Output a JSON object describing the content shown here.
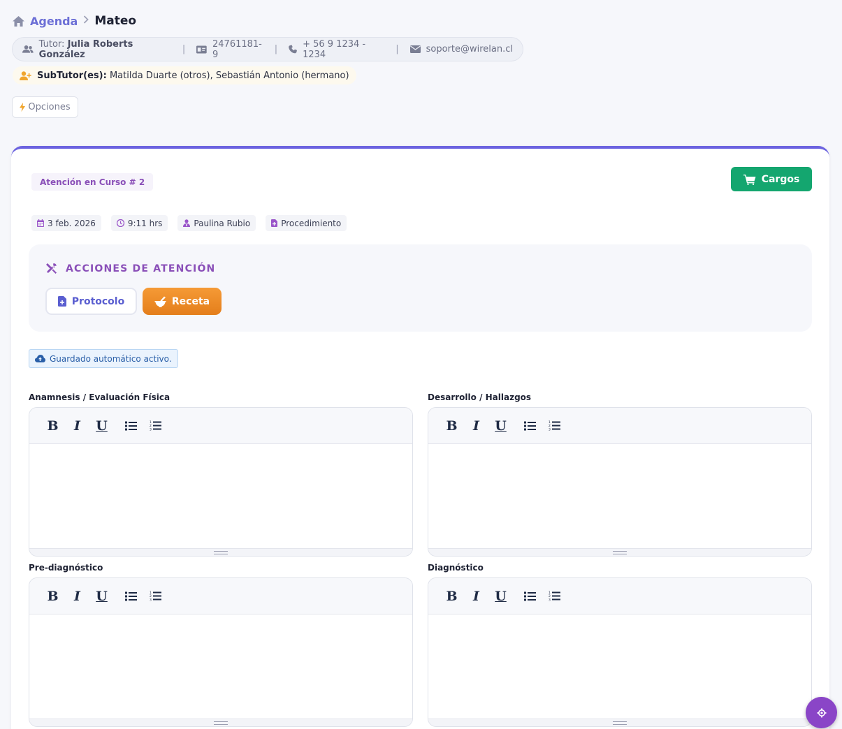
{
  "breadcrumb": {
    "home_icon": "home-icon",
    "link": "Agenda",
    "current": "Mateo"
  },
  "tutor": {
    "prefix": "Tutor:",
    "name": "Julia Roberts González",
    "rut": "24761181-9",
    "phone": "+ 56 9 1234 - 1234",
    "email": "soporte@wirelan.cl"
  },
  "subtutor": {
    "label": "SubTutor(es):",
    "value": "Matilda Duarte (otros), Sebastián Antonio (hermano)"
  },
  "opciones": {
    "label": "Opciones"
  },
  "atencion": {
    "badge": "Atención en Curso # 2",
    "cargos": "Cargos",
    "date": "3 feb. 2026",
    "time": "9:11 hrs",
    "professional": "Paulina Rubio",
    "type": "Procedimiento"
  },
  "acciones": {
    "title": "ACCIONES DE ATENCIÓN",
    "protocolo": "Protocolo",
    "receta": "Receta"
  },
  "autosave": "Guardado automático activo.",
  "editors": {
    "anamnesis": "Anamnesis / Evaluación Física",
    "desarrollo": "Desarrollo / Hallazgos",
    "prediagnostico": "Pre-diagnóstico",
    "diagnostico": "Diagnóstico"
  },
  "toolbar": {
    "bold": "B",
    "italic": "I",
    "underline": "U"
  },
  "colors": {
    "accent": "#6c63e0",
    "purple": "#8a4fb8",
    "green": "#14a66f",
    "orange": "#f0902b"
  }
}
